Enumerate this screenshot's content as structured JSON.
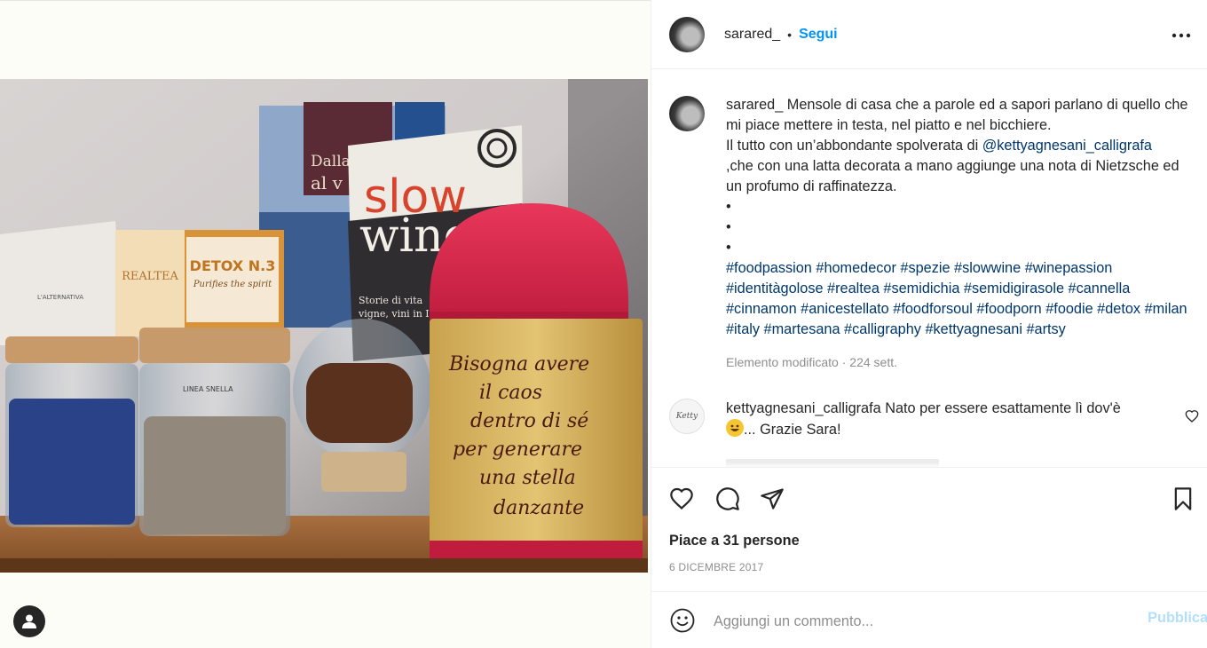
{
  "post": {
    "username": "sarared_",
    "follow_label": "Segui",
    "separator": "•",
    "caption_lines": [
      "Mensole di casa che a parole ed a sapori parlano di quello che mi piace mettere in testa, nel piatto e nel bicchiere."
    ],
    "caption_line2_prefix": "Il tutto con un’abbondante spolverata di ",
    "caption_mention": "@kettyagnesani_calligrafa",
    "caption_line3": ",che con una latta decorata a mano aggiunge una nota di Nietzsche ed un profumo di raffinatezza.",
    "bullets": [
      "•",
      "•",
      "•"
    ],
    "hashtags": "#foodpassion #homedecor #spezie #slowwine #winepassion #identitàgolose #realtea #semidichia #semidigirasole #cannella #cinnamon #anicestellato #foodforsoul #foodporn #foodie #detox #milan #italy #martesana #calligraphy #kettyagnesani #artsy",
    "meta": "Elemento modificato · 224 sett.",
    "likes": "Piace a 31 persone",
    "date": "6 DICEMBRE 2017"
  },
  "comment": {
    "username": "kettyagnesani_calligrafa",
    "text": "Nato per essere esattamente lì dov'è",
    "text_after_emoji": "... Grazie Sara!",
    "avatar_text": "Ketty"
  },
  "add_comment": {
    "placeholder": "Aggiungi un commento...",
    "publish_label": "Pubblica"
  },
  "photo": {
    "book1_top": "Dalla",
    "book1_bottom": "al v",
    "slow_word": "slow",
    "wine_word": "wine",
    "book2_sub1": "Storie di vita",
    "book2_sub2": "vigne, vini in Itali",
    "tea_brand": "REALTEA",
    "detox_title": "DETOX N.3",
    "detox_sub": "Purifies the spirit",
    "bag_label": "L'ALTERNATIVA",
    "jar_label": "LINEA SNELLA",
    "tin_text": [
      "Bisogna avere",
      "il caos",
      "dentro di sé",
      "per generare",
      "una stella",
      "danzante"
    ]
  },
  "colors": {
    "link": "#00376b",
    "follow": "#0095f6",
    "publish_disabled": "#b2dffc",
    "tin_red": "#d9234a"
  }
}
